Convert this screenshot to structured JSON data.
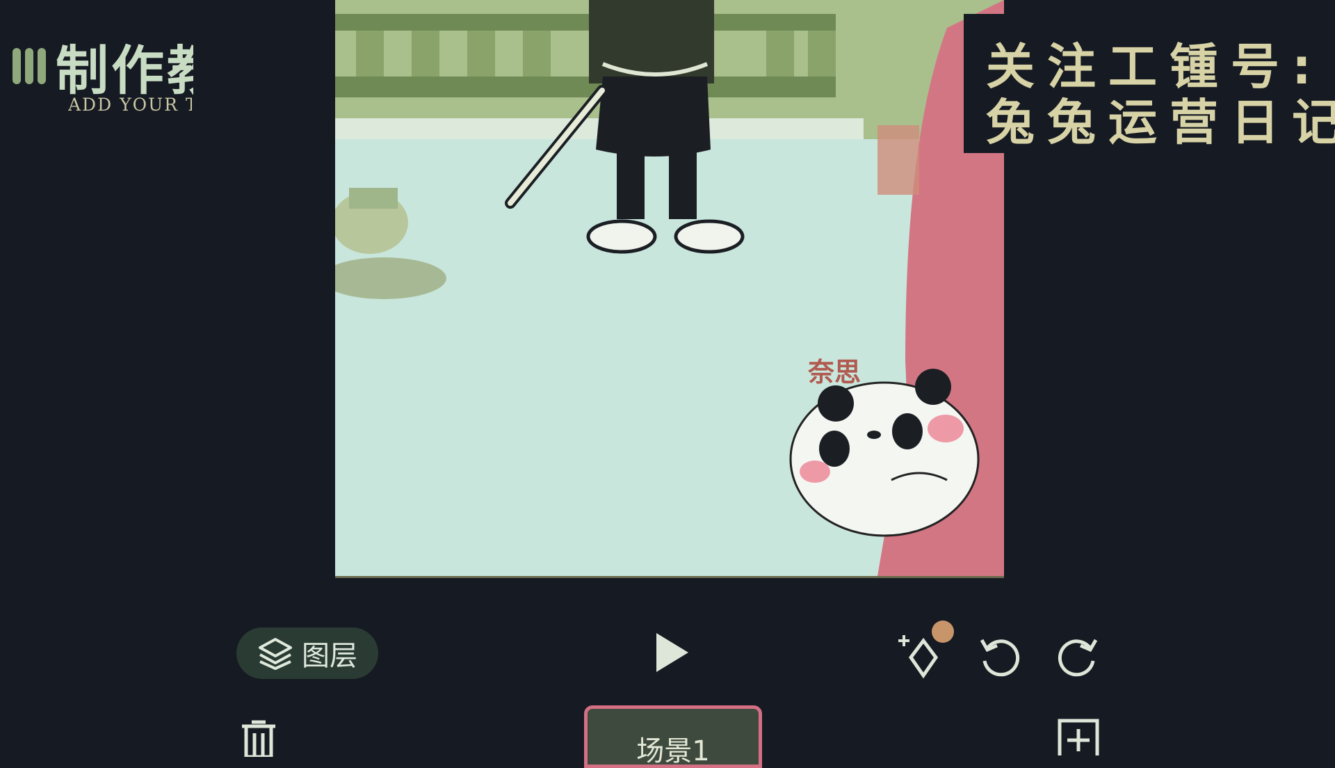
{
  "header": {
    "title": "制作教",
    "subtitle": "ADD YOUR TITI"
  },
  "watermark": {
    "line1": "关注工锺号:",
    "line2": "兔兔运营日记"
  },
  "canvas": {
    "sticker_text": "奈思"
  },
  "toolbar": {
    "layers_label": "图层",
    "play_icon": "play-icon",
    "keyframe_icon": "keyframe-icon",
    "undo_icon": "undo-icon",
    "redo_icon": "redo-icon"
  },
  "bottom_bar": {
    "scene_label": "场景1",
    "delete_icon": "trash-icon",
    "add_icon": "add-scene-icon"
  },
  "colors": {
    "background": "#161a22",
    "canvas": "#c9e6dd",
    "accent_pink": "#d46f84",
    "watermark_text": "#d7d3a6"
  }
}
